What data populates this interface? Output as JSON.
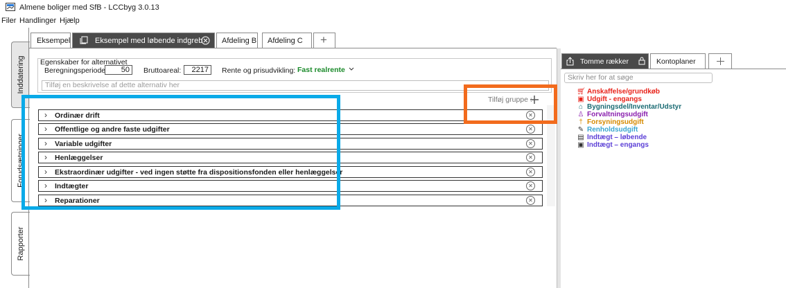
{
  "window": {
    "title": "Almene boliger med SfB - LCCbyg 3.0.13"
  },
  "menu": [
    "Filer",
    "Handlinger",
    "Hjælp"
  ],
  "side_tabs": [
    "Inddatering",
    "Forudsætninger",
    "Rapporter"
  ],
  "tabs": [
    {
      "label": "Eksempel",
      "active": false
    },
    {
      "label": "Eksempel med løbende indgreb",
      "active": true
    },
    {
      "label": "Afdeling B",
      "active": false
    },
    {
      "label": "Afdeling C",
      "active": false
    }
  ],
  "add_tab": "+",
  "properties": {
    "heading": "Egenskaber for alternativet",
    "period_label": "Beregningsperiode:",
    "period_value": "50",
    "area_label": "Bruttoareal:",
    "area_value": "2217",
    "rate_label": "Rente og prisudvikling:",
    "rate_value": "Fast realrente",
    "description_placeholder": "Tilføj en beskrivelse af dette alternativ her"
  },
  "add_group": "Tilføj gruppe :",
  "groups": [
    "Ordinær drift",
    "Offentlige og andre faste udgifter",
    "Variable udgifter",
    "Henlæggelser",
    "Ekstraordinær udgifter - ved ingen støtte fra dispositionsfonden eller henlæggelser",
    "Indtægter",
    "Reparationer"
  ],
  "right_panel": {
    "tabs": [
      "Tomme rækker",
      "Kontoplaner"
    ],
    "search_placeholder": "Skriv her for at søge",
    "accounts": [
      {
        "label": "Anskaffelse/grundkøb",
        "color": "#e8231a",
        "icon": "cart-icon"
      },
      {
        "label": "Udgift - engangs",
        "color": "#e8231a",
        "icon": "box-icon"
      },
      {
        "label": "Bygningsdel/Inventar/Udstyr",
        "color": "#1a6b73",
        "icon": "house-icon"
      },
      {
        "label": "Forvaltningsudgift",
        "color": "#8a1fae",
        "icon": "person-icon"
      },
      {
        "label": "Forsyningsudgift",
        "color": "#d68a00",
        "icon": "torch-icon"
      },
      {
        "label": "Renholdsudgift",
        "color": "#3aa6d0",
        "icon": "broom-icon"
      },
      {
        "label": "Indtægt – løbende",
        "color": "#5b3fd6",
        "icon": "cash-icon"
      },
      {
        "label": "Indtægt – engangs",
        "color": "#5b3fd6",
        "icon": "box-icon"
      }
    ]
  },
  "highlight_colors": {
    "blue": "#0aaae8",
    "orange": "#f26b1d"
  }
}
